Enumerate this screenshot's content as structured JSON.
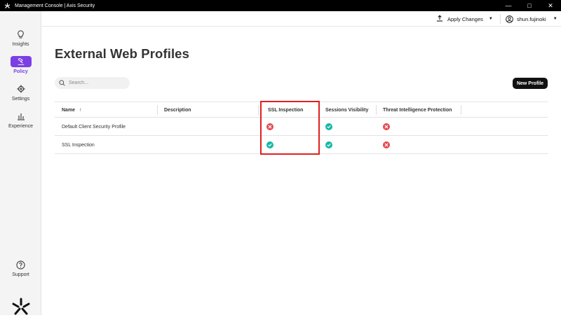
{
  "window": {
    "title": "Management Console | Axis Security"
  },
  "sidebar": {
    "items": [
      {
        "label": "Insights",
        "icon": "lightbulb-icon",
        "active": false
      },
      {
        "label": "Policy",
        "icon": "gavel-icon",
        "active": true
      },
      {
        "label": "Settings",
        "icon": "gear-icon",
        "active": false
      },
      {
        "label": "Experience",
        "icon": "bar-chart-icon",
        "active": false
      }
    ],
    "support": {
      "label": "Support",
      "icon": "question-circle-icon"
    },
    "logo": "axis-logo"
  },
  "topbar": {
    "apply_label": "Apply Changes",
    "user_name": "shun.fujinoki"
  },
  "main": {
    "title": "External Web Profiles",
    "search_placeholder": "Search...",
    "new_button": "New Profile",
    "table": {
      "columns": [
        "Name",
        "Description",
        "SSL Inspection",
        "Sessions Visibility",
        "Threat Intelligence Protection"
      ],
      "sort_indicator": "↑",
      "rows": [
        {
          "name": "Default Client Security Profile",
          "description": "",
          "ssl_inspection": false,
          "sessions_visibility": true,
          "threat_protection": false
        },
        {
          "name": "SSL Inspection",
          "description": "",
          "ssl_inspection": true,
          "sessions_visibility": true,
          "threat_protection": false
        }
      ]
    }
  },
  "colors": {
    "accent": "#7b3fe4",
    "ok": "#14b8a6",
    "error": "#e5484d",
    "highlight": "#e02020"
  }
}
